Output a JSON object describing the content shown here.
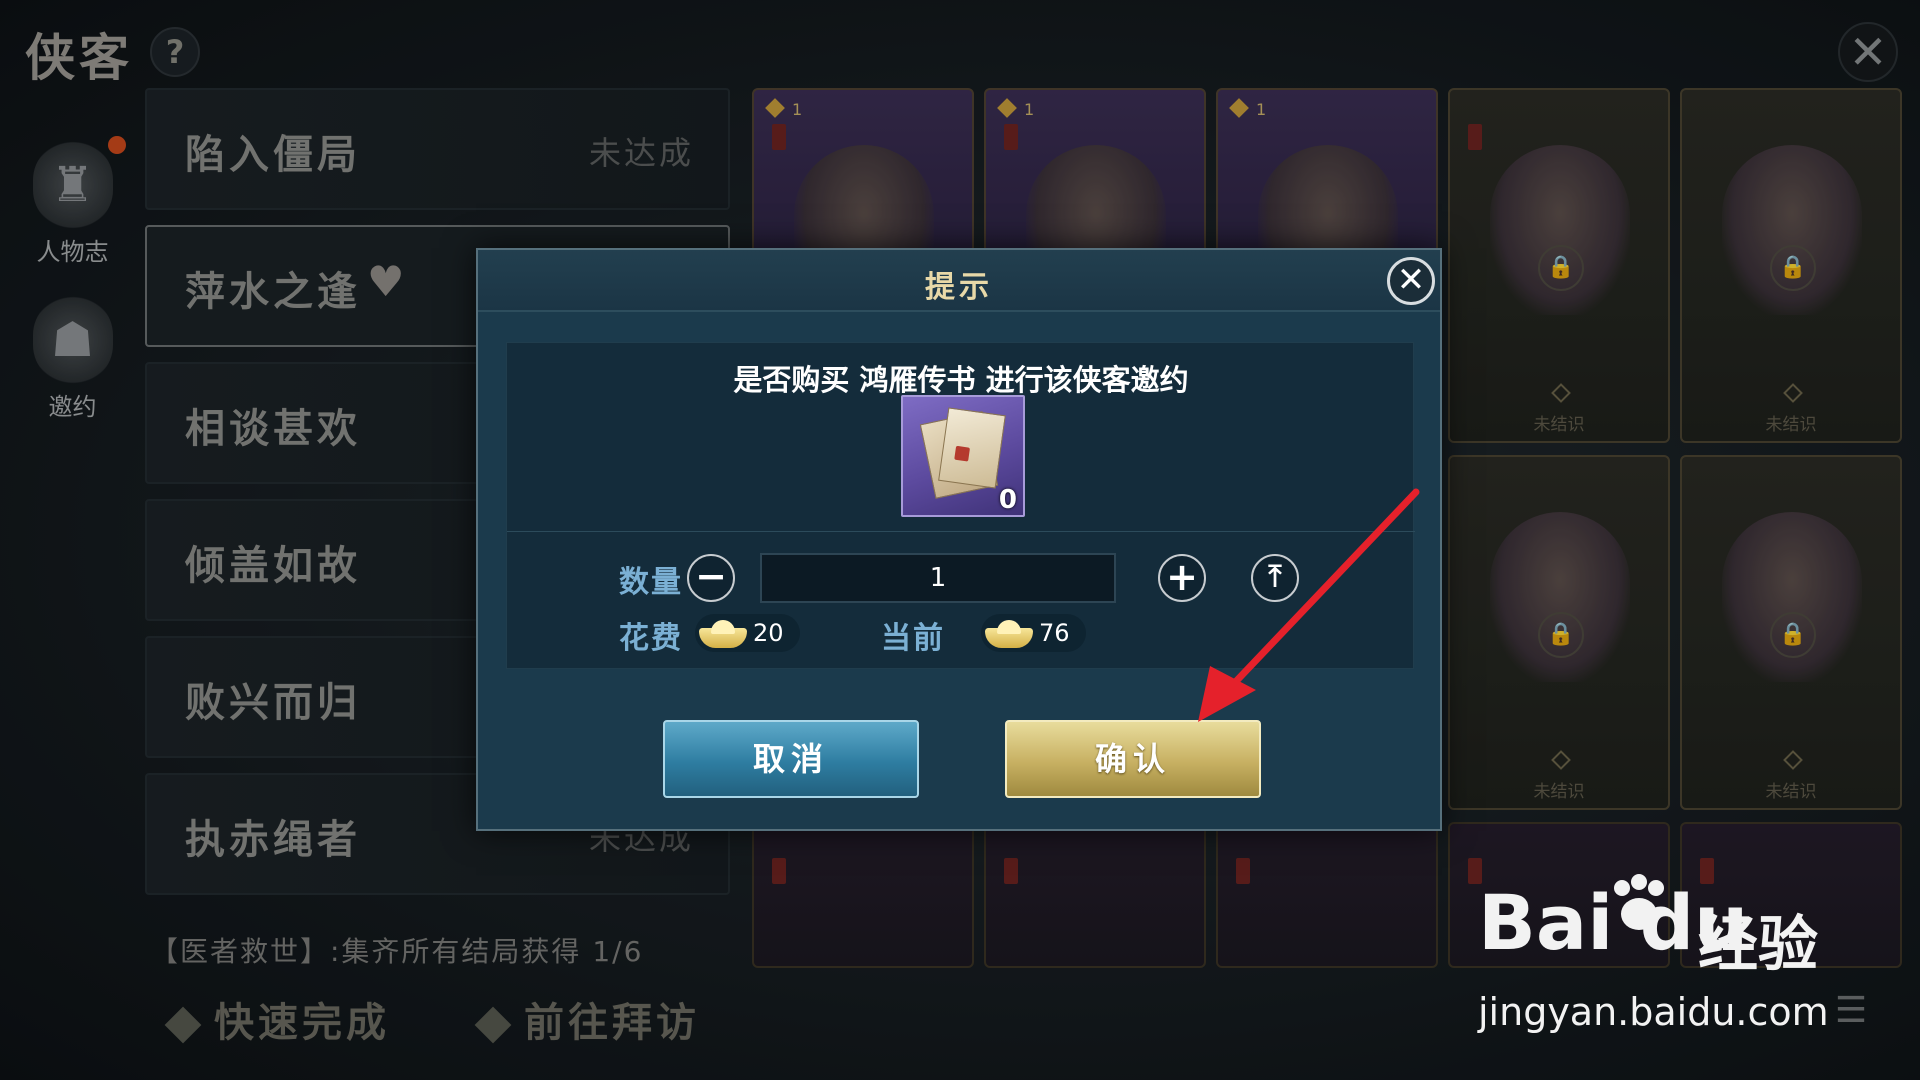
{
  "page": {
    "title": "侠客",
    "help_glyph": "?",
    "close_glyph": "✕"
  },
  "side_nav": [
    {
      "label": "人物志",
      "icon": "figure-icon",
      "has_badge": true
    },
    {
      "label": "邀约",
      "icon": "invite-emblem-icon",
      "has_badge": false
    }
  ],
  "endings": [
    {
      "name": "陷入僵局",
      "status": "未达成"
    },
    {
      "name": "萍水之逢",
      "status": "",
      "heart": "♥"
    },
    {
      "name": "相谈甚欢",
      "status": ""
    },
    {
      "name": "倾盖如故",
      "status": ""
    },
    {
      "name": "败兴而归",
      "status": ""
    },
    {
      "name": "执赤绳者",
      "status": "未达成"
    }
  ],
  "achievement": "【医者救世】:集齐所有结局获得 1/6",
  "actions": {
    "quick_complete": "快速完成",
    "go_visit": "前往拜访"
  },
  "cards": {
    "row1": [
      {
        "level": "1",
        "state": "unlocked"
      },
      {
        "level": "1",
        "state": "unlocked"
      },
      {
        "level": "1",
        "state": "unlocked"
      },
      {
        "label": "未结识",
        "state": "locked"
      },
      {
        "label": "未结识",
        "state": "locked"
      }
    ],
    "row2": [
      {
        "label": "未结识",
        "state": "locked"
      },
      {
        "label": "未结识",
        "state": "locked"
      }
    ]
  },
  "dialog": {
    "title": "提示",
    "close_glyph": "✕",
    "prompt": "是否购买 鸿雁传书 进行该侠客邀约",
    "item_count": "0",
    "quantity_label": "数量",
    "quantity_value": "1",
    "minus_glyph": "−",
    "plus_glyph": "+",
    "max_glyph": "⤒",
    "cost_label": "花费",
    "cost_value": "20",
    "current_label": "当前",
    "current_value": "76",
    "cancel_label": "取消",
    "confirm_label": "确认"
  },
  "watermark": {
    "logo": "Bai du",
    "brand": "经验",
    "url": "jingyan.baidu.com"
  },
  "colors": {
    "dialog_bg": "#1b3a4c",
    "cancel": "#2e7da1",
    "confirm": "#c7b062",
    "arrow": "#e5212b",
    "label_blue": "#7bb0d4"
  }
}
